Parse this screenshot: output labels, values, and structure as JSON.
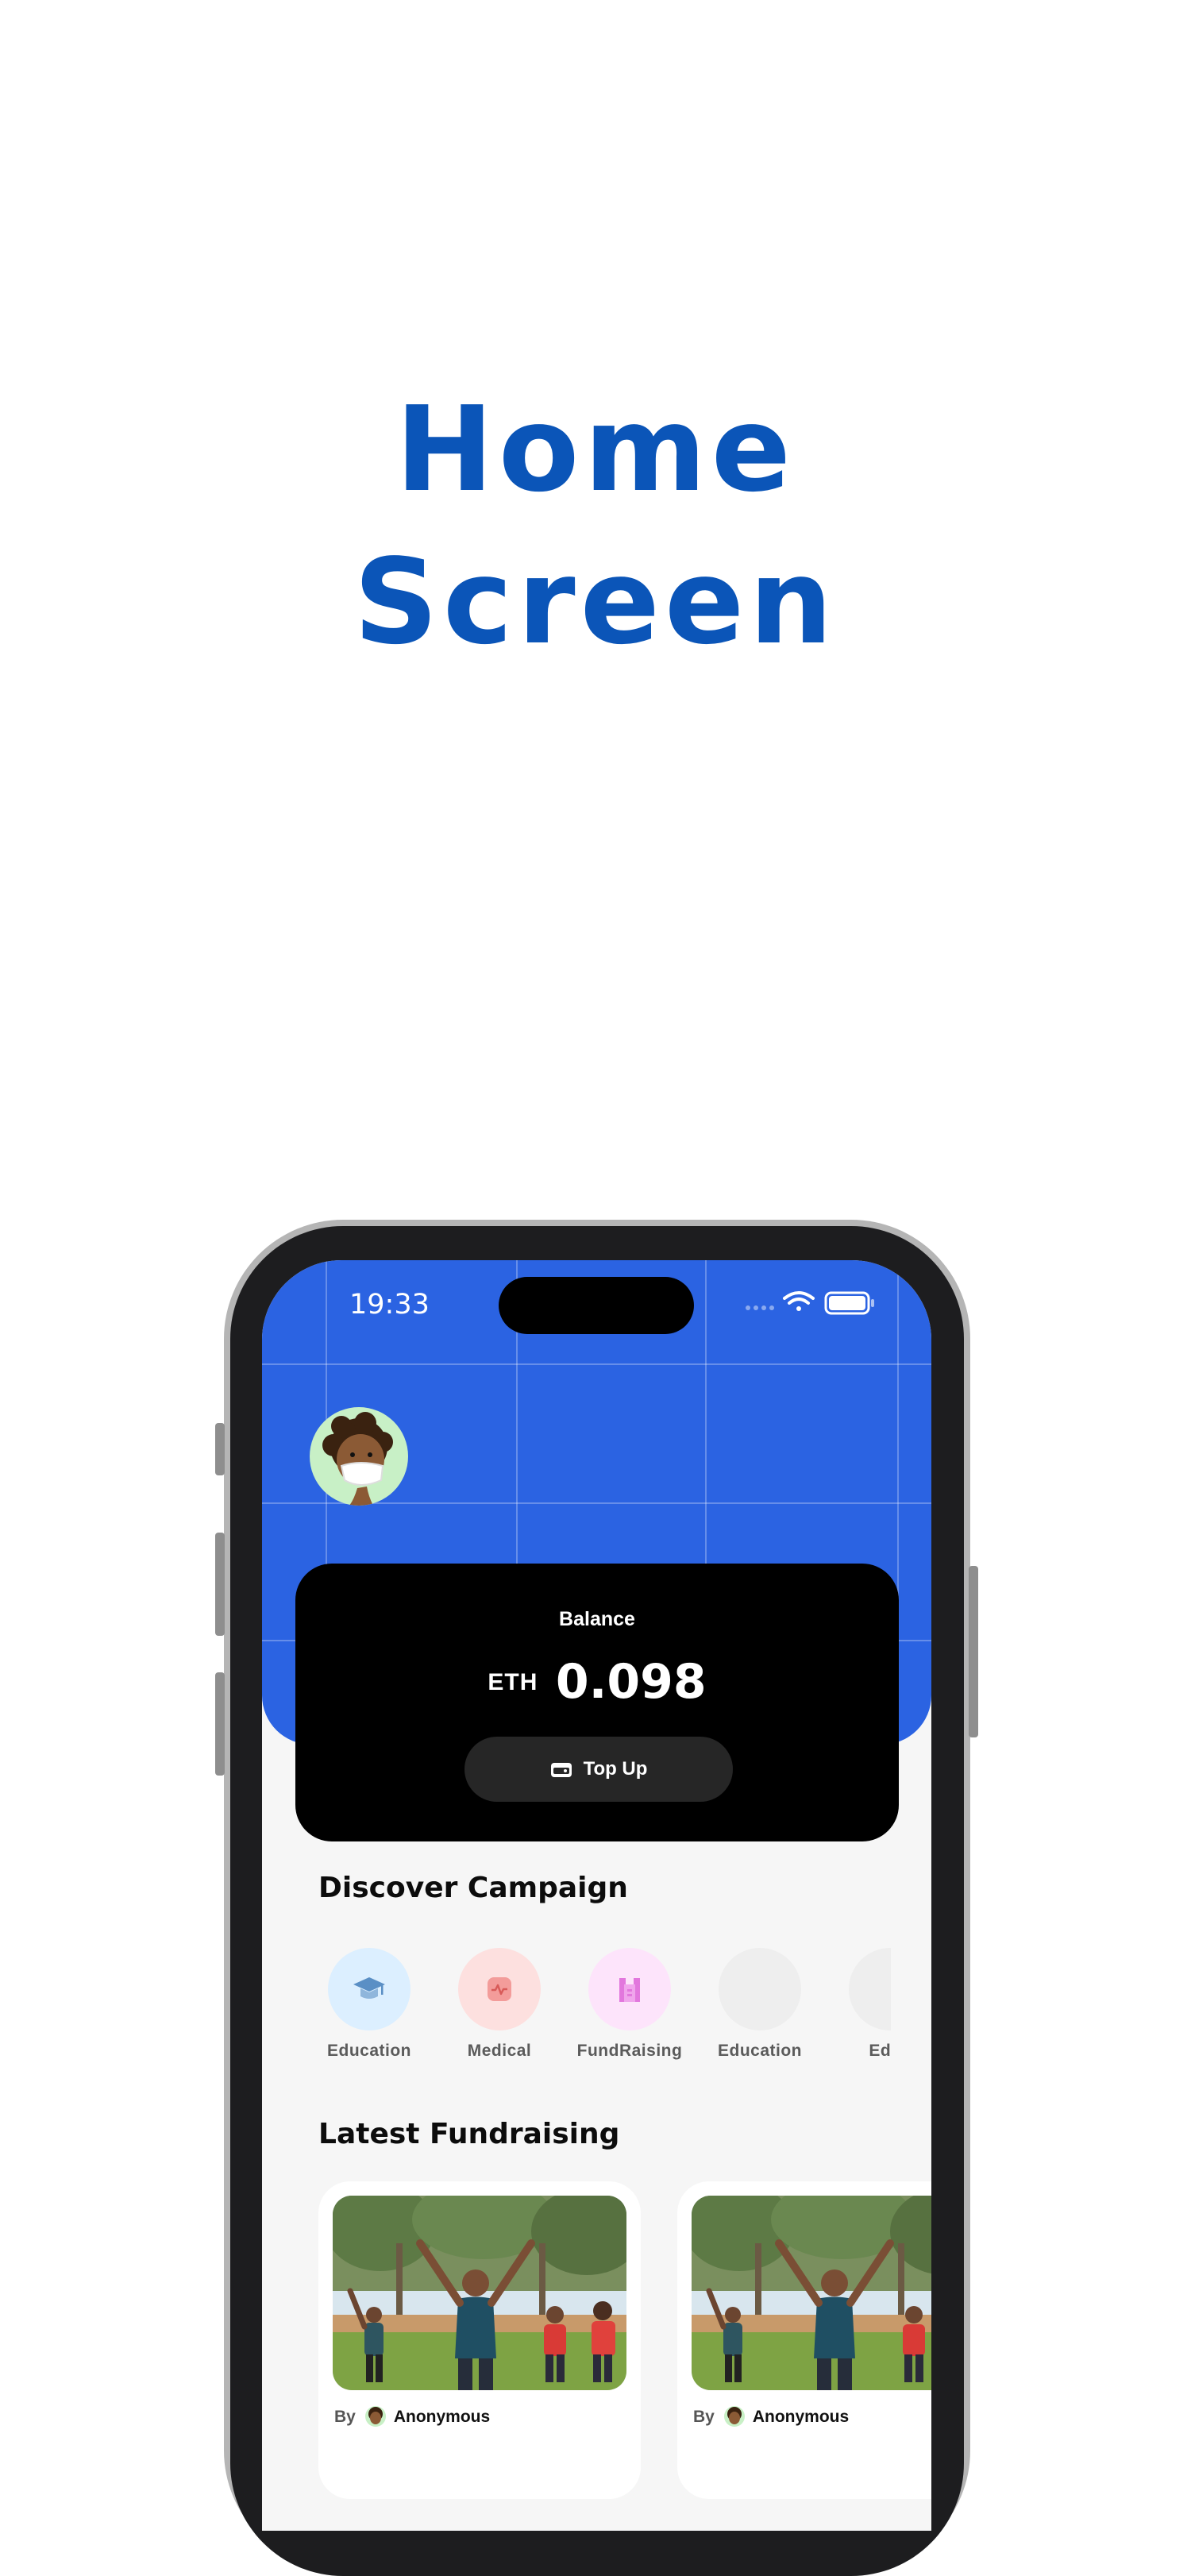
{
  "hero": {
    "title_line1": "Home",
    "title_line2": "Screen"
  },
  "status_bar": {
    "time": "19:33"
  },
  "balance": {
    "label": "Balance",
    "currency": "ETH",
    "amount": "0.098",
    "topup_label": "Top Up"
  },
  "discover": {
    "title": "Discover Campaign",
    "categories": [
      {
        "label": "Education",
        "icon": "graduation-cap-icon",
        "bg": "#dcefff",
        "color": "#5a8fc5"
      },
      {
        "label": "Medical",
        "icon": "heart-pulse-icon",
        "bg": "#fde0df",
        "color": "#f08585"
      },
      {
        "label": "FundRaising",
        "icon": "building-icon",
        "bg": "#fde4fb",
        "color": "#e277dd"
      },
      {
        "label": "Education",
        "icon": "",
        "bg": "#eeeeee",
        "color": "#eeeeee"
      },
      {
        "label": "Educ",
        "icon": "",
        "bg": "#eeeeee",
        "color": "#eeeeee"
      }
    ]
  },
  "latest": {
    "title": "Latest Fundraising",
    "cards": [
      {
        "by_label": "By",
        "author": "Anonymous"
      },
      {
        "by_label": "By",
        "author": "Anonymous"
      }
    ]
  },
  "colors": {
    "brand_blue": "#0b55b8",
    "header_blue": "#2b63e2",
    "card_black": "#000000"
  }
}
